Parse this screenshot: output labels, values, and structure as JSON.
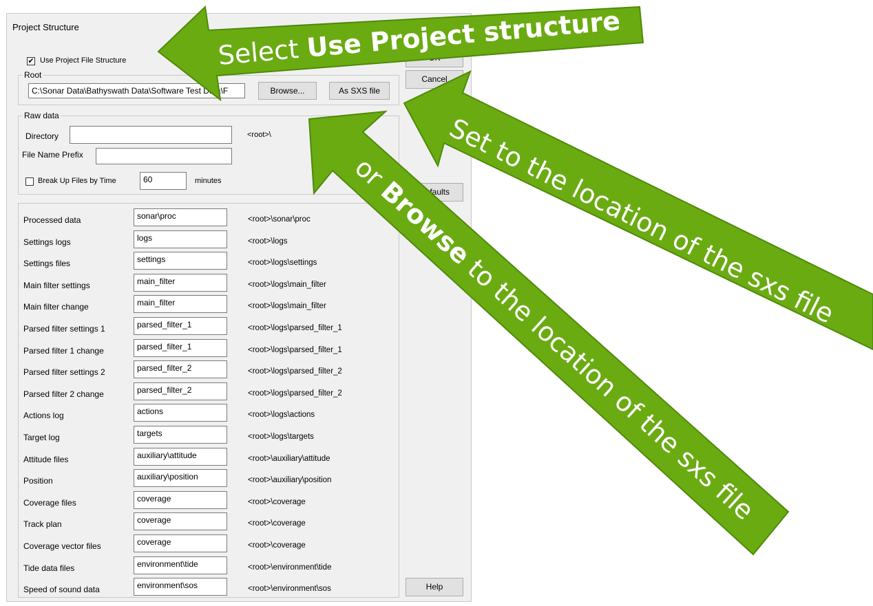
{
  "dialog": {
    "title": "Project Structure",
    "use_project_checkbox": {
      "label": "Use Project File Structure",
      "checked": "✔"
    },
    "root": {
      "legend": "Root",
      "path_value": "C:\\Sonar Data\\Bathyswath Data\\Software Test Data\\F",
      "browse_label": "Browse...",
      "as_sxs_label": "As SXS file"
    },
    "raw": {
      "legend": "Raw data",
      "directory_label": "Directory",
      "directory_value": "",
      "directory_path": "<root>\\",
      "prefix_label": "File Name Prefix",
      "prefix_value": "",
      "break_label": "Break Up Files by Time",
      "break_value": "60",
      "minutes_label": "minutes"
    },
    "rows": [
      {
        "label": "Processed data",
        "value": "sonar\\proc",
        "path": "<root>\\sonar\\proc"
      },
      {
        "label": "Settings logs",
        "value": "logs",
        "path": "<root>\\logs"
      },
      {
        "label": "Settings files",
        "value": "settings",
        "path": "<root>\\logs\\settings"
      },
      {
        "label": "Main filter settings",
        "value": "main_filter",
        "path": "<root>\\logs\\main_filter"
      },
      {
        "label": "Main filter change",
        "value": "main_filter",
        "path": "<root>\\logs\\main_filter"
      },
      {
        "label": "Parsed filter settings 1",
        "value": "parsed_filter_1",
        "path": "<root>\\logs\\parsed_filter_1"
      },
      {
        "label": "Parsed filter 1 change",
        "value": "parsed_filter_1",
        "path": "<root>\\logs\\parsed_filter_1"
      },
      {
        "label": "Parsed filter settings 2",
        "value": "parsed_filter_2",
        "path": "<root>\\logs\\parsed_filter_2"
      },
      {
        "label": "Parsed filter 2 change",
        "value": "parsed_filter_2",
        "path": "<root>\\logs\\parsed_filter_2"
      },
      {
        "label": "Actions log",
        "value": "actions",
        "path": "<root>\\logs\\actions"
      },
      {
        "label": "Target log",
        "value": "targets",
        "path": "<root>\\logs\\targets"
      },
      {
        "label": "Attitude files",
        "value": "auxiliary\\attitude",
        "path": "<root>\\auxiliary\\attitude"
      },
      {
        "label": "Position",
        "value": "auxiliary\\position",
        "path": "<root>\\auxiliary\\position"
      },
      {
        "label": "Coverage files",
        "value": "coverage",
        "path": "<root>\\coverage"
      },
      {
        "label": "Track plan",
        "value": "coverage",
        "path": "<root>\\coverage"
      },
      {
        "label": "Coverage vector files",
        "value": "coverage",
        "path": "<root>\\coverage"
      },
      {
        "label": "Tide data files",
        "value": "environment\\tide",
        "path": "<root>\\environment\\tide"
      },
      {
        "label": "Speed of sound data",
        "value": "environment\\sos",
        "path": "<root>\\environment\\sos"
      }
    ],
    "buttons": {
      "ok_label": "OK",
      "cancel_label": "Cancel",
      "defaults_label": "Defaults",
      "help_label": "Help"
    }
  },
  "annotations": {
    "select_prefix": "Select ",
    "select_bold": "Use Project structure",
    "set_location": "Set to the location of the sxs file",
    "or_prefix": "or ",
    "or_bold": "Browse",
    "or_suffix": " to the location of the sxs file",
    "arrow_color": "#6aab12",
    "arrow_border": "#4e8a08"
  }
}
